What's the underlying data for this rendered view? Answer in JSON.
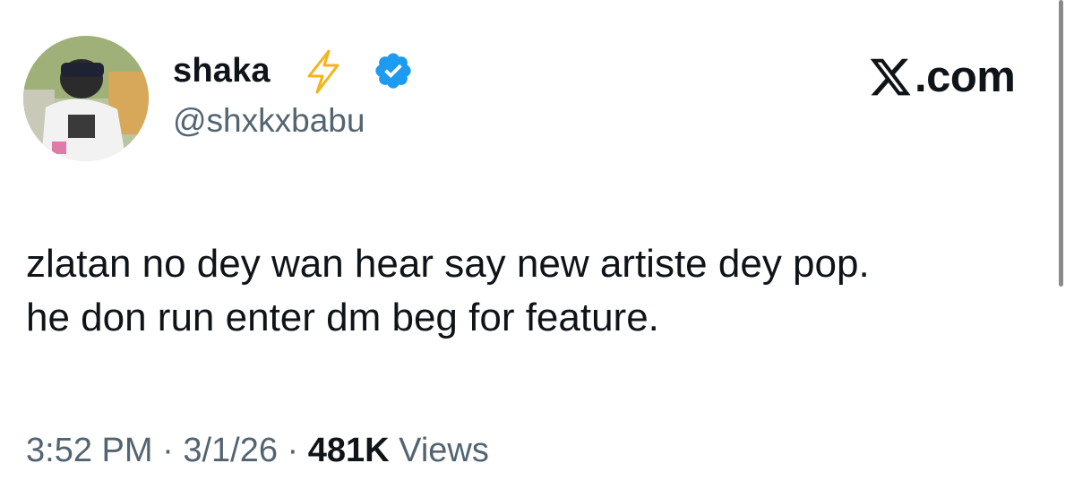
{
  "author": {
    "display_name": "shaka",
    "handle": "@shxkxbabu",
    "badge_emoji_icon": "lightning-bolt-icon",
    "verified_icon": "verified-badge-icon",
    "verified_color": "#1d9bf0",
    "bolt_color": "#f4b41a"
  },
  "brand": {
    "logo_icon": "x-logo-icon",
    "domain": ".com"
  },
  "tweet": {
    "lines": [
      "zlatan no dey wan hear say new artiste dey pop.",
      "he don run enter dm beg for feature."
    ]
  },
  "meta": {
    "time": "3:52 PM",
    "separator": " · ",
    "date": "3/1/26",
    "views_count": "481K",
    "views_label": "Views"
  },
  "colors": {
    "text": "#0f1419",
    "secondary": "#536471"
  }
}
